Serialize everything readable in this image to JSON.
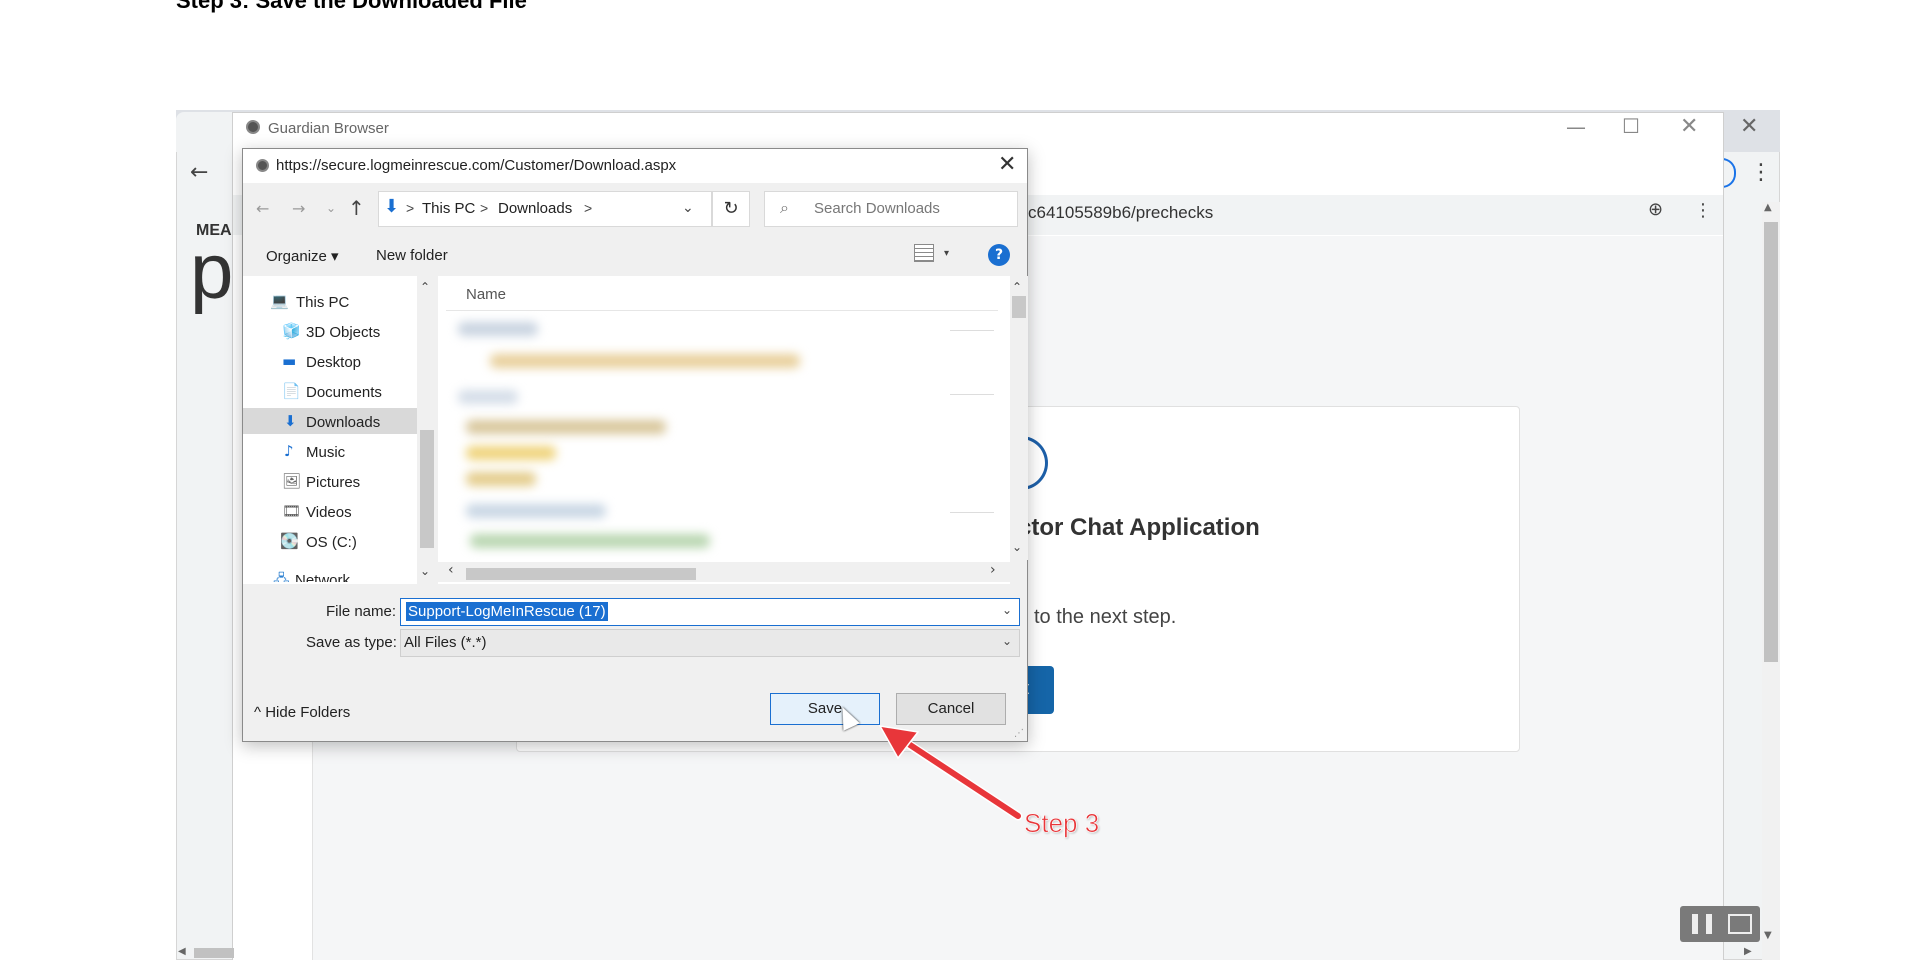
{
  "page": {
    "heading": "Step 3: Save the Downloaded File"
  },
  "outer_browser": {
    "close_glyph": "✕",
    "back_glyph": "←",
    "menu_glyph": "⋮"
  },
  "guardian_window": {
    "title": "Guardian Browser",
    "minimize_glyph": "—",
    "maximize_glyph": "☐",
    "close_glyph": "✕",
    "url_fragment": "c64105589b6/prechecks",
    "zoom_glyph": "⊕",
    "menu_glyph": "⋮",
    "brand_small": "MEA",
    "brand_large": "p"
  },
  "card": {
    "title_fragment": "ctor Chat Application",
    "text_fragment": "l to the next step.",
    "button_fragment": "t",
    "accent_color": "#1565a8"
  },
  "dialog": {
    "title": "https://secure.logmeinrescue.com/Customer/Download.aspx",
    "close_glyph": "✕",
    "nav": {
      "back": "←",
      "forward": "→",
      "recent": "⌄",
      "up": "↑",
      "refresh": "↻"
    },
    "breadcrumb": {
      "icon": "⬇",
      "sep": ">",
      "items": [
        "This PC",
        "Downloads"
      ],
      "dropdown": "⌄"
    },
    "search": {
      "placeholder": "Search Downloads",
      "icon": "⌕"
    },
    "toolbar": {
      "organize": "Organize ▾",
      "new_folder": "New folder",
      "view_drop": "▾",
      "help": "?"
    },
    "nav_pane": {
      "items": [
        {
          "label": "This PC",
          "icon": "💻"
        },
        {
          "label": "3D Objects",
          "icon": "🧊"
        },
        {
          "label": "Desktop",
          "icon": "▬"
        },
        {
          "label": "Documents",
          "icon": "📄"
        },
        {
          "label": "Downloads",
          "icon": "⬇"
        },
        {
          "label": "Music",
          "icon": "♪"
        },
        {
          "label": "Pictures",
          "icon": "🖼"
        },
        {
          "label": "Videos",
          "icon": "🎞"
        },
        {
          "label": "OS (C:)",
          "icon": "💽"
        },
        {
          "label": "Network",
          "icon": "🖧"
        }
      ],
      "selected": "Downloads"
    },
    "file_list": {
      "column_name": "Name"
    },
    "file_name": {
      "label": "File name:",
      "value": "Support-LogMeInRescue (17)"
    },
    "save_type": {
      "label": "Save as type:",
      "value": "All Files (*.*)"
    },
    "hide_folders": "^ Hide Folders",
    "save_label": "Save",
    "cancel_label": "Cancel",
    "selection_color": "#1a6fd1"
  },
  "annotation": {
    "label": "Step 3",
    "color": "#e8363a"
  }
}
